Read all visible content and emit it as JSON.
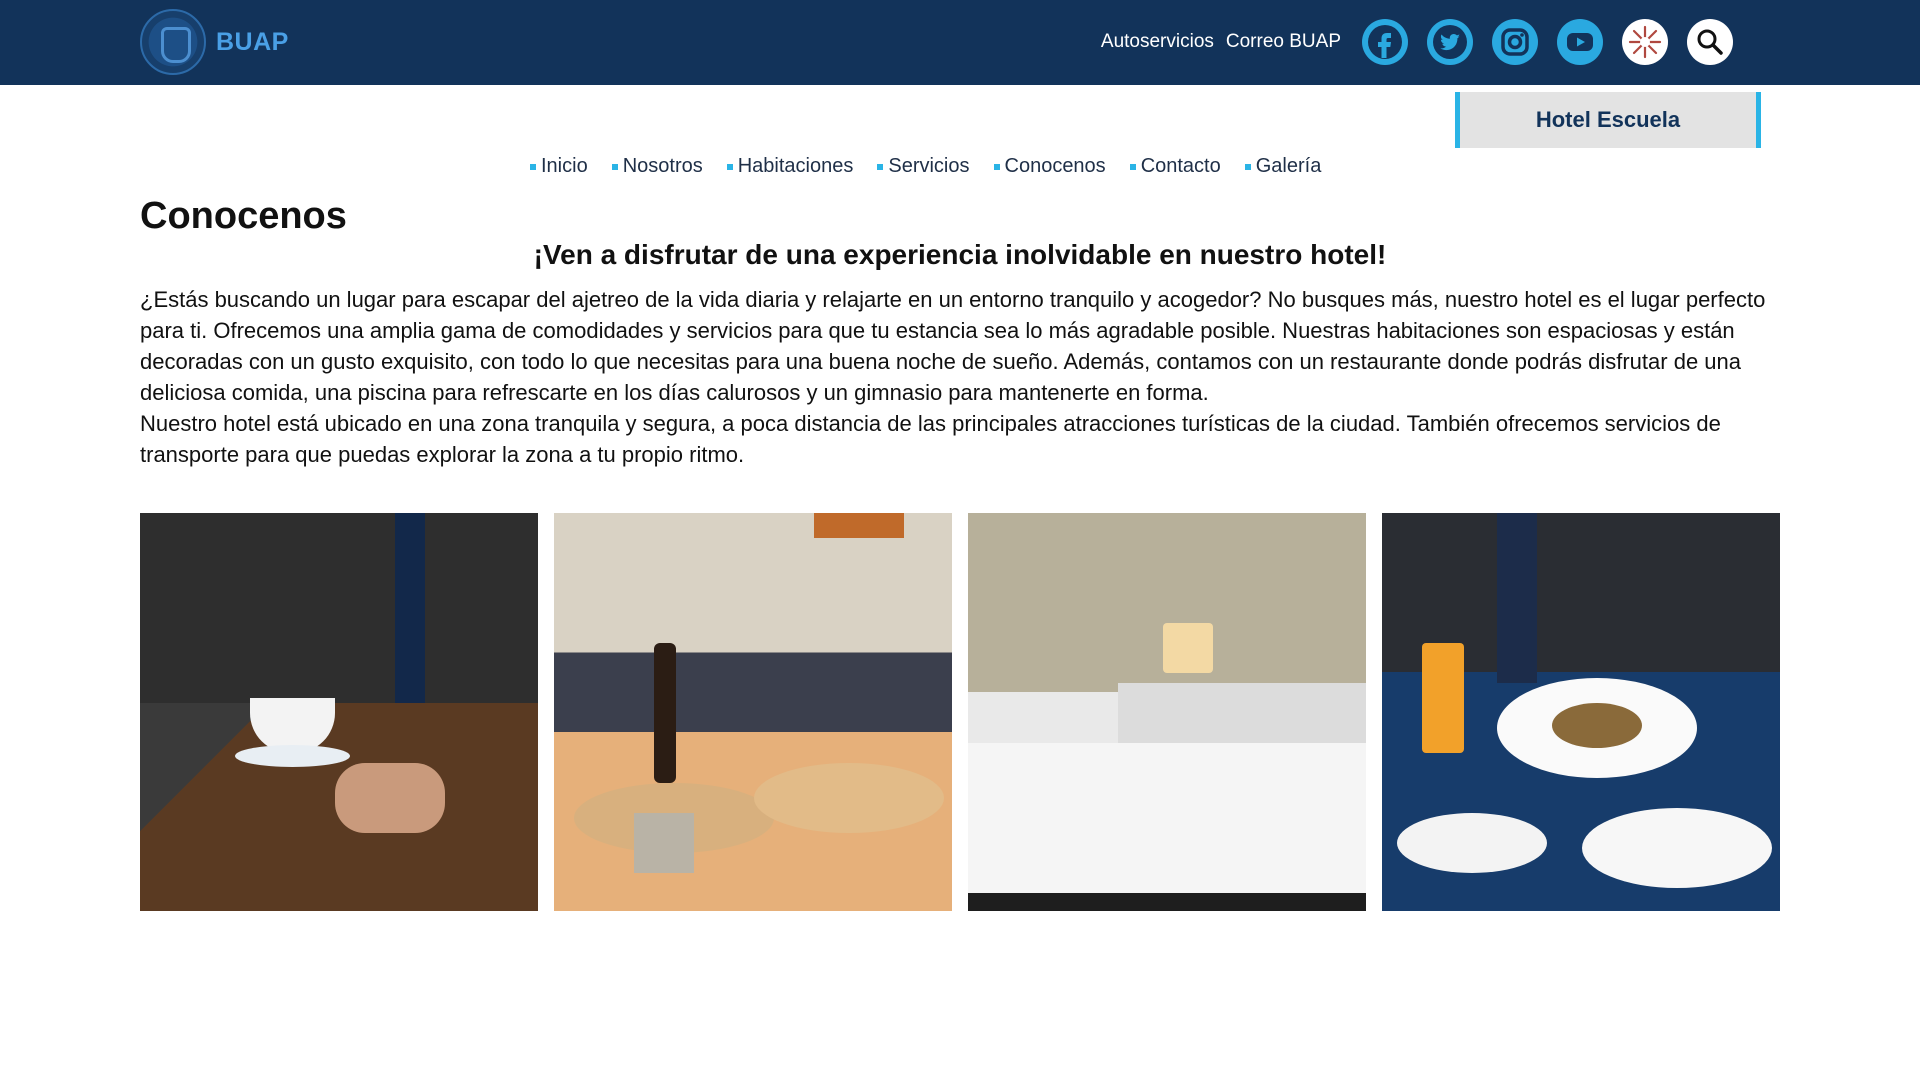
{
  "header": {
    "brand": "BUAP",
    "links": [
      "Autoservicios",
      "Correo BUAP"
    ],
    "social_icons": [
      "facebook-icon",
      "twitter-icon",
      "instagram-icon",
      "youtube-icon",
      "flower-logo-icon",
      "search-icon"
    ],
    "bar_color": "#12335a",
    "accent_color": "#2aa9e0"
  },
  "hotel_tab": {
    "label": "Hotel Escuela"
  },
  "nav": {
    "items": [
      "Inicio",
      "Nosotros",
      "Habitaciones",
      "Servicios",
      "Conocenos",
      "Contacto",
      "Galería"
    ]
  },
  "main": {
    "title": "Conocenos",
    "headline": "¡Ven a disfrutar de una experiencia inolvidable en nuestro hotel!",
    "paragraph1": "¿Estás buscando un lugar para escapar del ajetreo de la vida diaria y relajarte en un entorno tranquilo y acogedor? No busques más, nuestro hotel es el lugar perfecto para ti. Ofrecemos una amplia gama de comodidades y servicios para que tu estancia sea lo más agradable posible. Nuestras habitaciones son espaciosas y están decoradas con un gusto exquisito, con todo lo que necesitas para una buena noche de sueño. Además, contamos con un restaurante donde podrás disfrutar de una deliciosa comida, una piscina para refrescarte en los días calurosos y un gimnasio para mantenerte en forma.",
    "paragraph2": "Nuestro hotel está ubicado en una zona tranquila y segura, a poca distancia de las principales atracciones turísticas de la ciudad. También ofrecemos servicios de transporte para que puedas explorar la zona a tu propio ritmo."
  },
  "gallery": {
    "photos": [
      "coffee-businessman-photo",
      "chef-plating-photo",
      "hotel-bedroom-photo",
      "dining-table-photo"
    ]
  }
}
